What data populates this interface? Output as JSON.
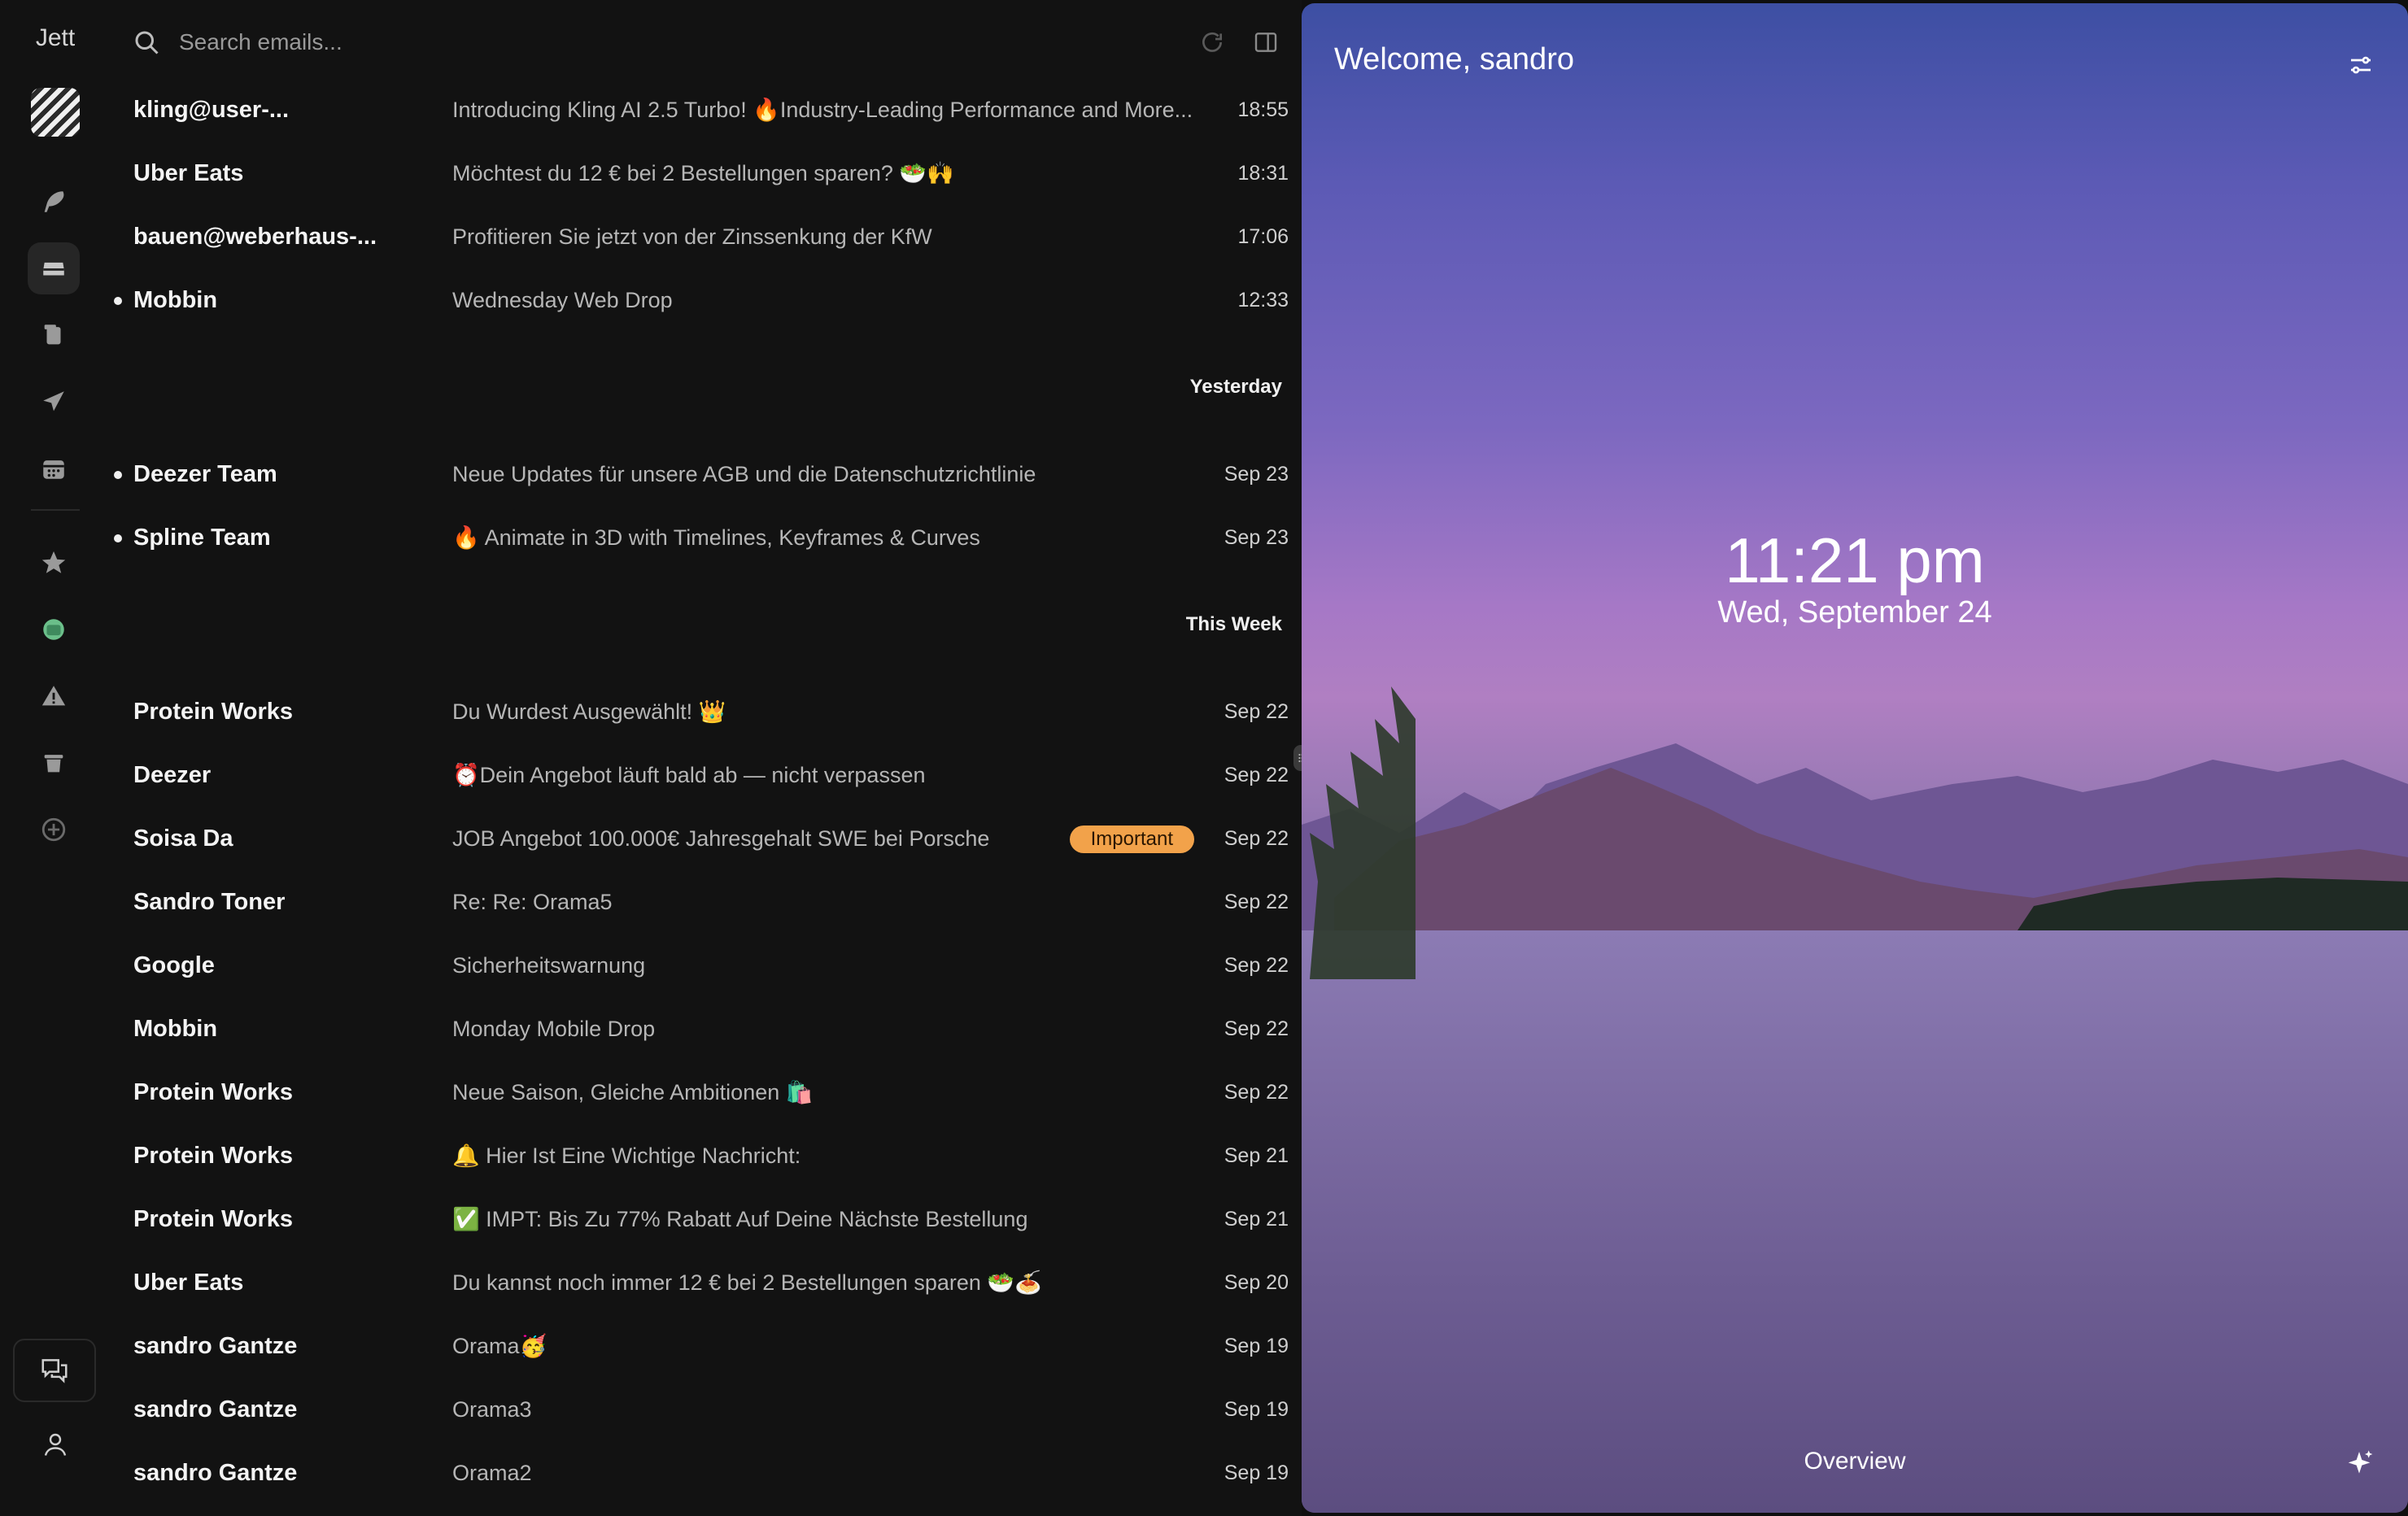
{
  "rail": {
    "brand": "Jett",
    "icons": [
      "feather-icon",
      "inbox-icon",
      "files-icon",
      "send-icon",
      "calendar-icon",
      "star-icon",
      "archive-icon",
      "warning-icon",
      "trash-icon",
      "add-icon"
    ]
  },
  "search": {
    "placeholder": "Search emails..."
  },
  "groups": {
    "yesterday": "Yesterday",
    "this_week": "This Week"
  },
  "emails": [
    {
      "sender": "kling@user-...",
      "subject": "Introducing Kling AI 2.5 Turbo! 🔥Industry-Leading Performance and More...",
      "date": "18:55",
      "unread": false
    },
    {
      "sender": "Uber Eats",
      "subject": "Möchtest du 12 € bei 2 Bestellungen sparen? 🥗🙌",
      "date": "18:31",
      "unread": false
    },
    {
      "sender": "bauen@weberhaus-...",
      "subject": "Profitieren Sie jetzt von der Zinssenkung der KfW",
      "date": "17:06",
      "unread": false
    },
    {
      "sender": "Mobbin",
      "subject": "Wednesday Web Drop",
      "date": "12:33",
      "unread": true
    },
    {
      "sender": "Deezer Team",
      "subject": "Neue Updates für unsere AGB und die Datenschutzrichtlinie",
      "date": "Sep 23",
      "unread": true
    },
    {
      "sender": "Spline Team",
      "subject": "🔥 Animate in 3D with Timelines, Keyframes & Curves",
      "date": "Sep 23",
      "unread": true
    },
    {
      "sender": "Protein Works",
      "subject": "Du Wurdest Ausgewählt! 👑",
      "date": "Sep 22",
      "unread": false
    },
    {
      "sender": "Deezer",
      "subject": "⏰Dein Angebot läuft bald ab — nicht verpassen",
      "date": "Sep 22",
      "unread": false
    },
    {
      "sender": "Soisa Da",
      "subject": "JOB Angebot 100.000€ Jahresgehalt SWE bei Porsche",
      "date": "Sep 22",
      "unread": false,
      "badge": "Important"
    },
    {
      "sender": "Sandro Toner",
      "subject": "Re: Re: Orama5",
      "date": "Sep 22",
      "unread": false
    },
    {
      "sender": "Google",
      "subject": "Sicherheitswarnung",
      "date": "Sep 22",
      "unread": false
    },
    {
      "sender": "Mobbin",
      "subject": "Monday Mobile Drop",
      "date": "Sep 22",
      "unread": false
    },
    {
      "sender": "Protein Works",
      "subject": "Neue Saison, Gleiche Ambitionen 🛍️",
      "date": "Sep 22",
      "unread": false
    },
    {
      "sender": "Protein Works",
      "subject": "🔔 Hier Ist Eine Wichtige Nachricht:",
      "date": "Sep 21",
      "unread": false
    },
    {
      "sender": "Protein Works",
      "subject": "✅ IMPT: Bis Zu 77% Rabatt Auf Deine Nächste Bestellung",
      "date": "Sep 21",
      "unread": false
    },
    {
      "sender": "Uber Eats",
      "subject": "Du kannst noch immer 12 € bei 2 Bestellungen sparen 🥗🍝",
      "date": "Sep 20",
      "unread": false
    },
    {
      "sender": "sandro Gantze",
      "subject": "Orama🥳",
      "date": "Sep 19",
      "unread": false
    },
    {
      "sender": "sandro Gantze",
      "subject": "Orama3",
      "date": "Sep 19",
      "unread": false
    },
    {
      "sender": "sandro Gantze",
      "subject": "Orama2",
      "date": "Sep 19",
      "unread": false
    }
  ],
  "panel": {
    "welcome": "Welcome, sandro",
    "time": "11:21 pm",
    "date": "Wed, September 24",
    "overview": "Overview"
  }
}
